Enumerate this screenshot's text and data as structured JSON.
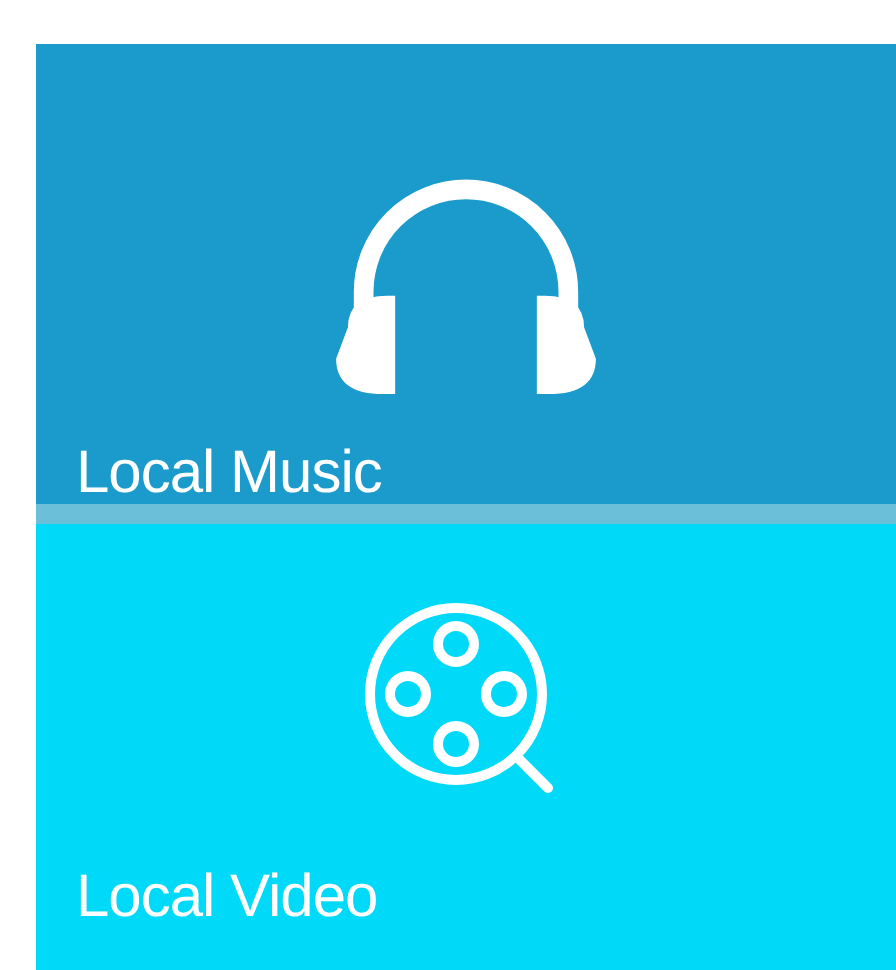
{
  "tiles": [
    {
      "kind": "music",
      "label": "Local Music"
    },
    {
      "kind": "video",
      "label": "Local Video"
    }
  ]
}
